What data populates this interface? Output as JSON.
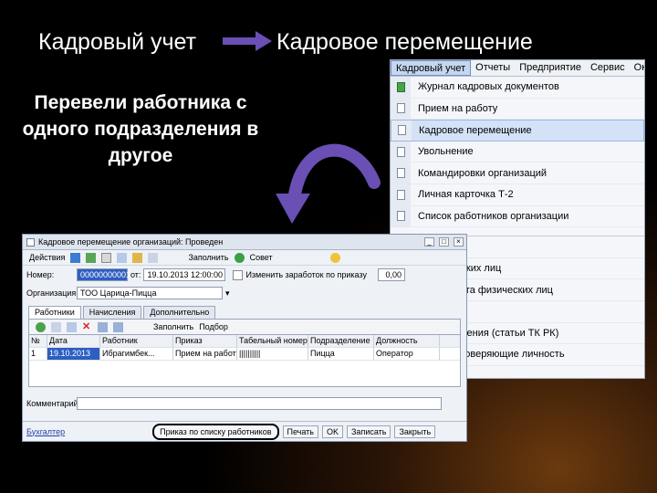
{
  "header": {
    "left": "Кадровый учет",
    "right": "Кадровое перемещение"
  },
  "left_note": "Перевели работника с одного подразделения в другое",
  "menu_window": {
    "menubar": [
      {
        "label": "Кадровый учет",
        "active": true
      },
      {
        "label": "Отчеты"
      },
      {
        "label": "Предприятие"
      },
      {
        "label": "Сервис"
      },
      {
        "label": "Окна"
      }
    ],
    "items": [
      {
        "label": "Журнал кадровых документов",
        "icon": "journal-icon"
      },
      {
        "label": "Прием на работу",
        "icon": "document-icon"
      },
      {
        "label": "Кадровое перемещение",
        "icon": "document-icon",
        "highlighted": true
      },
      {
        "label": "Увольнение",
        "icon": "document-icon"
      },
      {
        "label": "Командировки организаций",
        "icon": "document-icon"
      },
      {
        "label": "Личная карточка Т-2",
        "icon": "card-icon"
      },
      {
        "label": "Список работников организации",
        "icon": "list-icon"
      },
      {
        "label": "...ые лица",
        "icon": "list-icon"
      },
      {
        "label": "...физических лиц",
        "icon": "list-icon"
      },
      {
        "label": "...карт-счета физических лиц",
        "icon": "list-icon"
      },
      {
        "label": "...и",
        "icon": "list-icon"
      },
      {
        "label": "...я увольнения (статьи ТК РК)",
        "icon": "list-icon"
      },
      {
        "label": "...ы, удостоверяющие личность",
        "icon": "list-icon"
      }
    ]
  },
  "doc_window": {
    "title": "Кадровое перемещение организаций: Проведен",
    "toolbar": {
      "actions": "Действия",
      "fill": "Заполнить",
      "advice": "Совет"
    },
    "number_label": "Номер:",
    "number_value": "00000000001",
    "date_label": "от:",
    "date_value": "19.10.2013 12:00:00",
    "checkbox_label": "Изменить заработок по приказу",
    "org_label": "Организация:",
    "org_value": "ТОО Царица-Пицца",
    "amount_value": "0,00",
    "tabs": [
      {
        "label": "Работники",
        "active": true
      },
      {
        "label": "Начисления"
      },
      {
        "label": "Дополнительно"
      }
    ],
    "grid_toolbar": {
      "fill": "Заполнить",
      "select": "Подбор"
    },
    "columns": [
      "№",
      "Дата",
      "Работник",
      "Приказ",
      "Табельный номер",
      "Подразделение",
      "Должность"
    ],
    "rows": [
      [
        "1",
        "19.10.2013",
        "Ибрагимбек...",
        "Прием на работу",
        "||||||||||",
        "Пицца",
        "Оператор"
      ]
    ],
    "comment_label": "Комментарий:",
    "bottom": {
      "accountant": "Бухгалтер",
      "order_list": "Приказ по списку работников",
      "print": "Печать",
      "ok": "OK",
      "write": "Записать",
      "close": "Закрыть"
    }
  },
  "annotation_mark": "1",
  "colors": {
    "arrow": "#6a4fb4",
    "accent_highlight": "#d3e2f7"
  }
}
